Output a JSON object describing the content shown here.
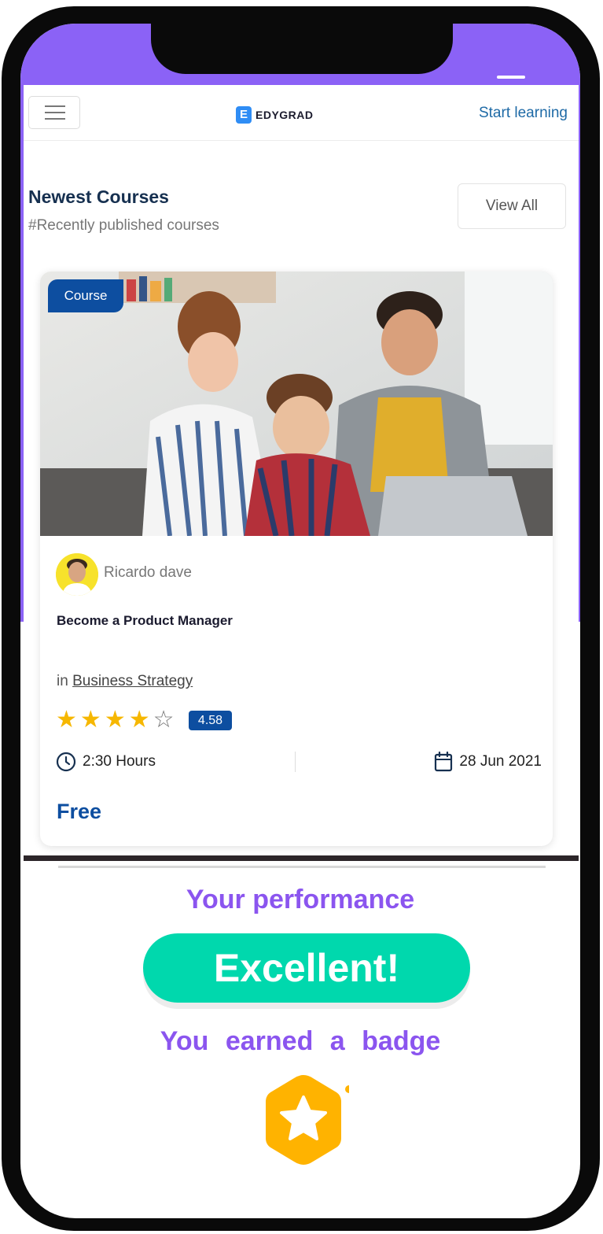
{
  "header": {
    "logo_text": "EDYGRAD",
    "logo_letter": "E",
    "start_learning": "Start learning"
  },
  "section": {
    "title": "Newest Courses",
    "subtitle": "#Recently published courses",
    "view_all": "View All"
  },
  "course": {
    "badge": "Course",
    "author": "Ricardo dave",
    "title": "Become a Product Manager",
    "category_prefix": "in",
    "category": "Business Strategy",
    "rating_stars": 4,
    "rating_max": 5,
    "rating_value": "4.58",
    "duration": "2:30 Hours",
    "date": "28 Jun 2021",
    "price": "Free"
  },
  "performance": {
    "title": "Your performance",
    "result": "Excellent!",
    "earned": "You  earned a badge"
  },
  "icons": {
    "menu": "hamburger-icon",
    "clock": "clock-icon",
    "calendar": "calendar-icon",
    "star": "star-icon",
    "badge": "hexagon-star-badge-icon"
  },
  "colors": {
    "accent_purple": "#8b62f6",
    "brand_blue": "#0d4ea0",
    "link_blue": "#1e6aa6",
    "success_green": "#00d8ad",
    "star_yellow": "#f6b700",
    "badge_orange": "#ffb300"
  }
}
